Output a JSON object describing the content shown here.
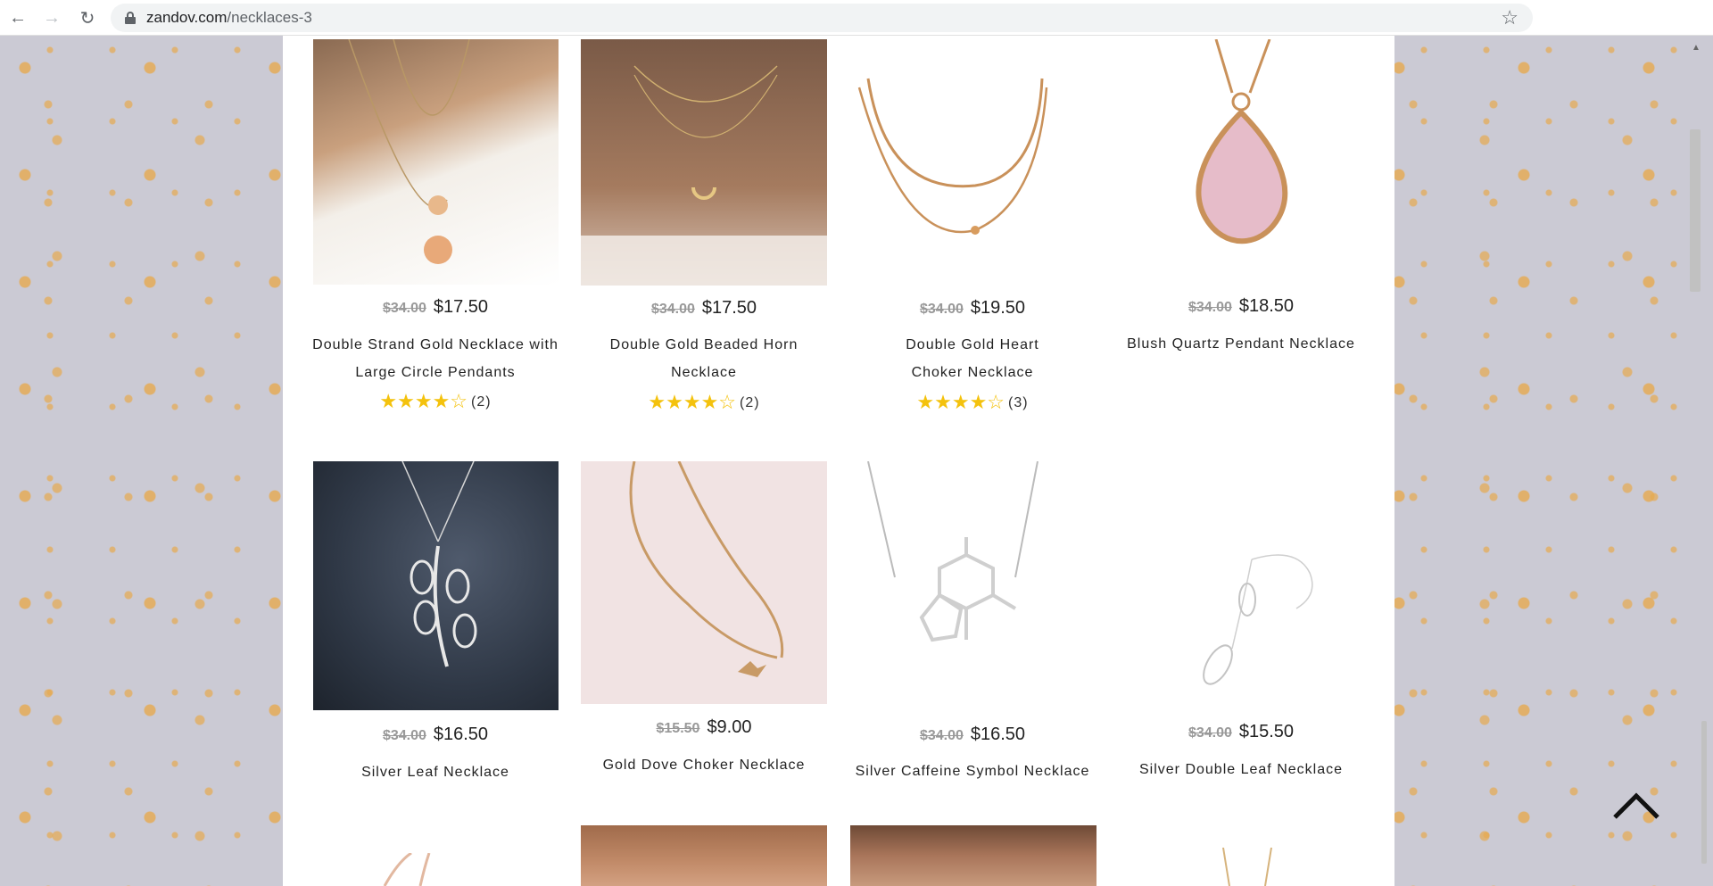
{
  "browser": {
    "url_domain": "zandov.com",
    "url_path": "/necklaces-3"
  },
  "products": [
    {
      "old_price": "$34.00",
      "price": "$17.50",
      "name": "Double Strand Gold Necklace with Large Circle Pendants",
      "stars": "★★★★☆",
      "reviews": "(2)",
      "rating_value": 4
    },
    {
      "old_price": "$34.00",
      "price": "$17.50",
      "name": "Double Gold Beaded Horn Necklace",
      "stars": "★★★★☆",
      "reviews": "(2)",
      "rating_value": 4
    },
    {
      "old_price": "$34.00",
      "price": "$19.50",
      "name": "Double Gold Heart Choker Necklace",
      "stars": "★★★★☆",
      "reviews": "(3)",
      "rating_value": 4
    },
    {
      "old_price": "$34.00",
      "price": "$18.50",
      "name": "Blush Quartz Pendant Necklace"
    },
    {
      "old_price": "$34.00",
      "price": "$16.50",
      "name": "Silver Leaf Necklace"
    },
    {
      "old_price": "$15.50",
      "price": "$9.00",
      "name": "Gold Dove Choker Necklace"
    },
    {
      "old_price": "$34.00",
      "price": "$16.50",
      "name": "Silver Caffeine Symbol Necklace"
    },
    {
      "old_price": "$34.00",
      "price": "$15.50",
      "name": "Silver Double Leaf Necklace"
    }
  ],
  "colors": {
    "star": "#f4c20d",
    "old_price": "#999999",
    "text": "#222222"
  },
  "icons": {
    "back": "back-arrow-icon",
    "forward": "forward-arrow-icon",
    "reload": "reload-icon",
    "lock": "lock-icon",
    "bookmark": "star-icon",
    "scroll_top": "chevron-up-icon"
  }
}
